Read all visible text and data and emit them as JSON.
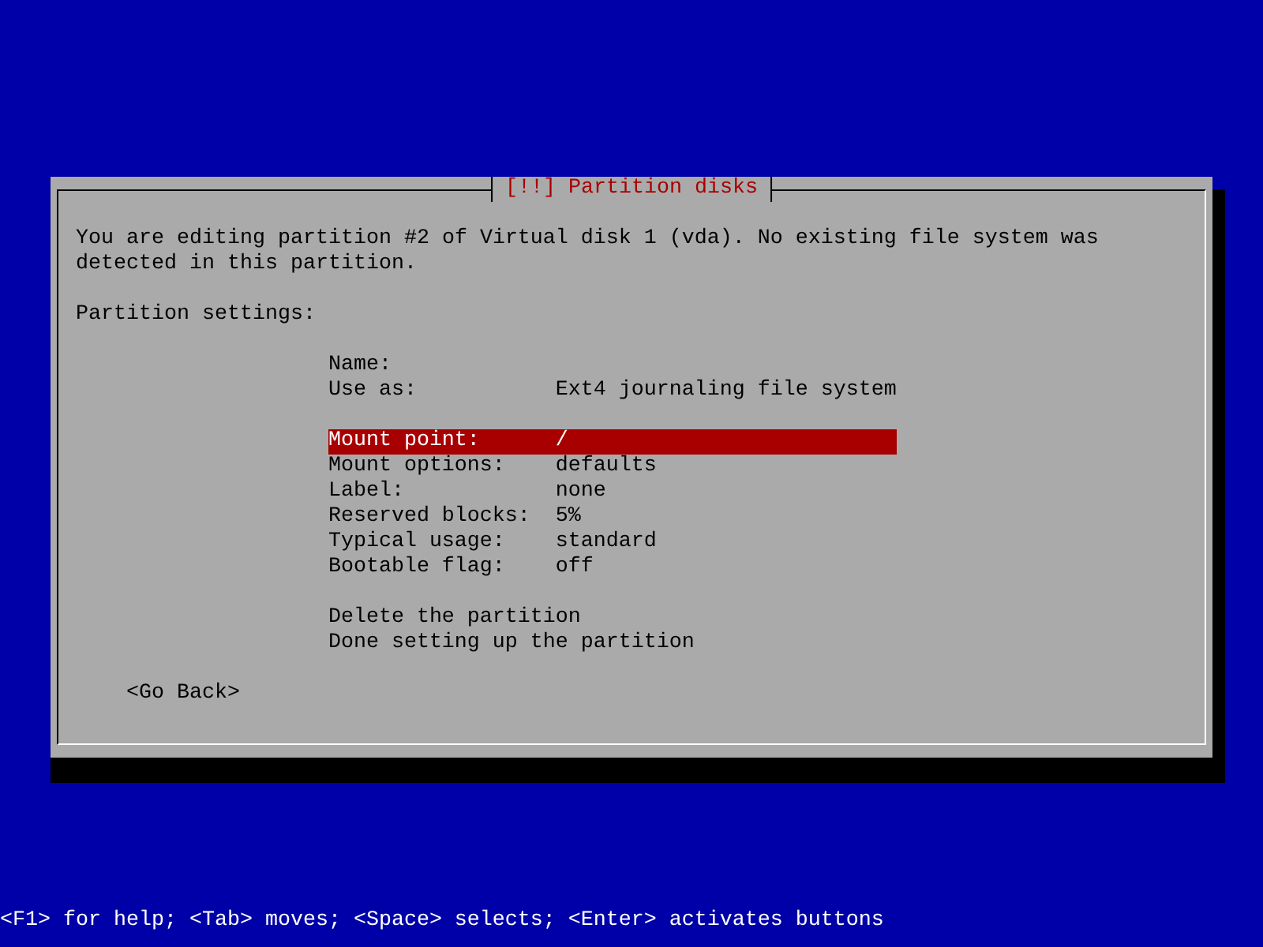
{
  "dialog": {
    "title": "[!!] Partition disks",
    "message": "You are editing partition #2 of Virtual disk 1 (vda). No existing file system was detected in this partition.",
    "section_label": "Partition settings:",
    "groups": [
      [
        {
          "label": "Name:",
          "selected": false
        },
        {
          "label": "Use as:",
          "value": "Ext4 journaling file system",
          "selected": false
        }
      ],
      [
        {
          "label": "Mount point:",
          "value": "/",
          "selected": true
        },
        {
          "label": "Mount options:",
          "value": "defaults",
          "selected": false
        },
        {
          "label": "Label:",
          "value": "none",
          "selected": false
        },
        {
          "label": "Reserved blocks:",
          "value": "5%",
          "selected": false
        },
        {
          "label": "Typical usage:",
          "value": "standard",
          "selected": false
        },
        {
          "label": "Bootable flag:",
          "value": "off",
          "selected": false
        }
      ],
      [
        {
          "label": "Delete the partition",
          "selected": false
        },
        {
          "label": "Done setting up the partition",
          "selected": false
        }
      ]
    ],
    "back_button": {
      "label": "<Go Back>",
      "selected": false
    }
  },
  "status_bar": "<F1> for help; <Tab> moves; <Space> selects; <Enter> activates buttons"
}
